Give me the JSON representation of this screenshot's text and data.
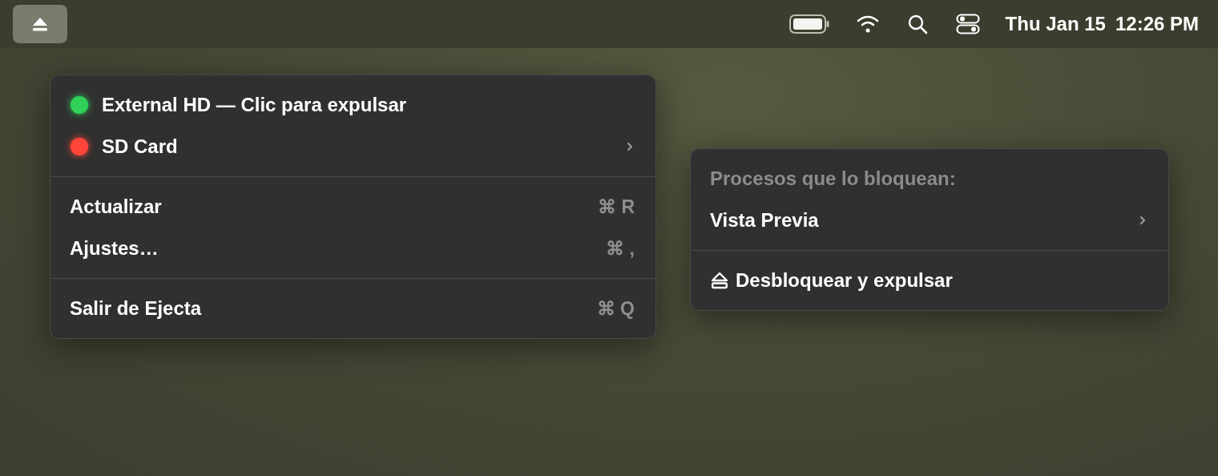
{
  "menu_bar": {
    "date": "Thu Jan 15",
    "time": "12:26 PM"
  },
  "menu": {
    "sections": [
      [
        {
          "kind": "volume",
          "label": "External HD — Clic para expulsar",
          "color": "#30d158",
          "submenu": false
        },
        {
          "kind": "volume",
          "label": "SD Card",
          "color": "#ff453a",
          "submenu": true
        }
      ],
      [
        {
          "kind": "action",
          "label": "Actualizar",
          "shortcut": "⌘ R"
        },
        {
          "kind": "action",
          "label": "Ajustes…",
          "shortcut": "⌘ ,"
        }
      ],
      [
        {
          "kind": "action",
          "label": "Salir de Ejecta",
          "shortcut": "⌘ Q"
        }
      ]
    ]
  },
  "submenu": {
    "sections": [
      [
        {
          "kind": "header",
          "label": "Procesos que lo bloquean:"
        },
        {
          "kind": "process",
          "label": "Vista Previa",
          "submenu": true
        }
      ],
      [
        {
          "kind": "eject",
          "label": "Desbloquear y expulsar"
        }
      ]
    ]
  }
}
